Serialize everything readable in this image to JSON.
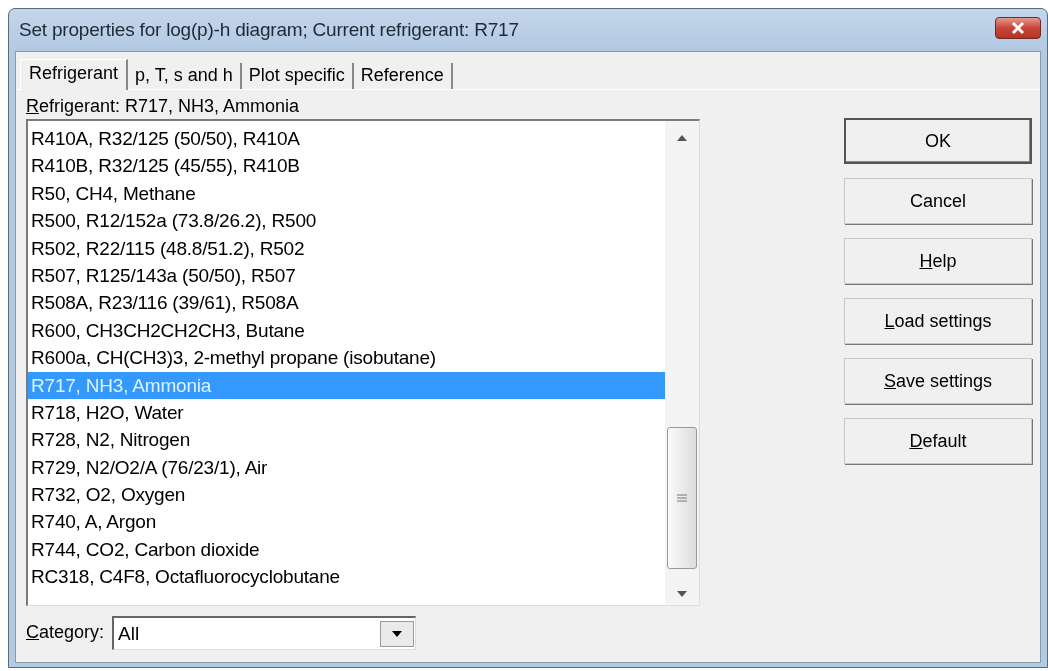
{
  "window": {
    "title": "Set properties for log(p)-h diagram; Current refrigerant: R717"
  },
  "tabs": [
    {
      "label": "Refrigerant",
      "selected": true
    },
    {
      "label": "p, T, s and h",
      "selected": false
    },
    {
      "label": "Plot specific",
      "selected": false
    },
    {
      "label": "Reference",
      "selected": false
    }
  ],
  "refrigerant_label": {
    "key": "R",
    "rest": "efrigerant:  R717, NH3, Ammonia"
  },
  "list": [
    {
      "label": "R410A, R32/125 (50/50), R410A",
      "selected": false
    },
    {
      "label": "R410B, R32/125 (45/55), R410B",
      "selected": false
    },
    {
      "label": "R50, CH4, Methane",
      "selected": false
    },
    {
      "label": "R500, R12/152a (73.8/26.2), R500",
      "selected": false
    },
    {
      "label": "R502, R22/115 (48.8/51.2), R502",
      "selected": false
    },
    {
      "label": "R507, R125/143a (50/50), R507",
      "selected": false
    },
    {
      "label": "R508A, R23/116 (39/61), R508A",
      "selected": false
    },
    {
      "label": "R600, CH3CH2CH2CH3, Butane",
      "selected": false
    },
    {
      "label": "R600a, CH(CH3)3, 2-methyl propane (isobutane)",
      "selected": false
    },
    {
      "label": "R717, NH3, Ammonia",
      "selected": true
    },
    {
      "label": "R718, H2O, Water",
      "selected": false
    },
    {
      "label": "R728, N2, Nitrogen",
      "selected": false
    },
    {
      "label": "R729, N2/O2/A (76/23/1), Air",
      "selected": false
    },
    {
      "label": "R732, O2, Oxygen",
      "selected": false
    },
    {
      "label": "R740, A, Argon",
      "selected": false
    },
    {
      "label": "R744, CO2, Carbon dioxide",
      "selected": false
    },
    {
      "label": "RC318, C4F8, Octafluorocyclobutane",
      "selected": false
    }
  ],
  "category": {
    "label": {
      "key": "C",
      "rest": "ategory:"
    },
    "value": "All"
  },
  "buttons": [
    {
      "rest": "OK",
      "default": true
    },
    {
      "rest": "Cancel",
      "default": false
    },
    {
      "key": "H",
      "rest": "elp",
      "default": false
    },
    {
      "key": "L",
      "rest": "oad settings",
      "default": false
    },
    {
      "key": "S",
      "rest": "ave settings",
      "default": false
    },
    {
      "key": "D",
      "rest": "efault",
      "default": false
    }
  ]
}
